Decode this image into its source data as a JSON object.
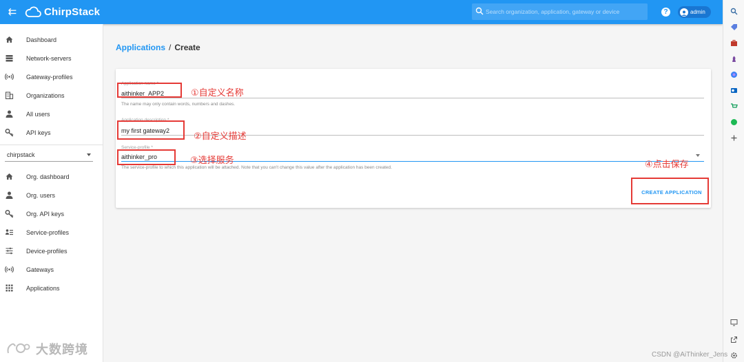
{
  "appbar": {
    "brand": "ChirpStack",
    "search_placeholder": "Search organization, application, gateway or device",
    "help_icon": "?",
    "user": "admin"
  },
  "sidebar": {
    "global_items": [
      {
        "label": "Dashboard",
        "icon": "home-icon"
      },
      {
        "label": "Network-servers",
        "icon": "server-icon"
      },
      {
        "label": "Gateway-profiles",
        "icon": "radio-tower-icon"
      },
      {
        "label": "Organizations",
        "icon": "building-icon"
      },
      {
        "label": "All users",
        "icon": "person-icon"
      },
      {
        "label": "API keys",
        "icon": "key-icon"
      }
    ],
    "org_selector": "chirpstack",
    "org_items": [
      {
        "label": "Org. dashboard",
        "icon": "home-icon"
      },
      {
        "label": "Org. users",
        "icon": "person-icon"
      },
      {
        "label": "Org. API keys",
        "icon": "key-icon"
      },
      {
        "label": "Service-profiles",
        "icon": "list-icon"
      },
      {
        "label": "Device-profiles",
        "icon": "sliders-icon"
      },
      {
        "label": "Gateways",
        "icon": "radio-tower-icon"
      },
      {
        "label": "Applications",
        "icon": "grid-icon"
      }
    ]
  },
  "breadcrumb": {
    "parent": "Applications",
    "separator": "/",
    "current": "Create"
  },
  "form": {
    "name": {
      "label": "Application name *",
      "value": "aithinker_APP2",
      "helper": "The name may only contain words, numbers and dashes."
    },
    "description": {
      "label": "Application description *",
      "value": "my first gateway2"
    },
    "service_profile": {
      "label": "Service-profile *",
      "value": "aithinker_pro",
      "helper": "The service-profile to which this application will be attached. Note that you can't change this value after the application has been created."
    },
    "submit_label": "CREATE APPLICATION"
  },
  "annotations": {
    "a1": "①自定义名称",
    "a2": "②自定义描述",
    "a3": "③选择服务",
    "a4": "④点击保存"
  },
  "watermarks": {
    "left": "大数跨境",
    "right": "CSDN @AiThinker_Jens"
  },
  "colors": {
    "appbar": "#2196f3",
    "accent": "#2196f3",
    "annotation": "#e53935"
  }
}
